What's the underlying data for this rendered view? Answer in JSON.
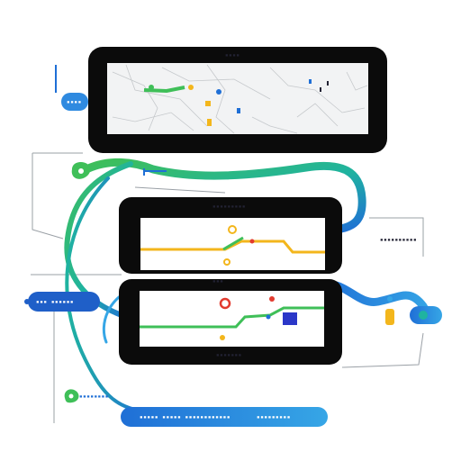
{
  "colors": {
    "frame": "#0b0b0b",
    "panel_bg": "#ffffff",
    "map_bg": "#f2f3f4",
    "blue": "#1f6fd6",
    "blue_light": "#36a6e6",
    "teal": "#1fb3a0",
    "green": "#3fbf58",
    "yellow": "#f3b61c",
    "red": "#e23b2f",
    "navy": "#2b37c8",
    "thin_line": "#9aa0a6"
  },
  "labels": {
    "map_title": "▪▪▪▪",
    "panel_a_title": "▪▪▪▪▪▪▪▪▪",
    "panel_b_title": "▪▪▪",
    "panel_b_footer": "▪▪▪▪▪▪▪",
    "right_caption": "▪▪▪▪▪▪▪▪▪▪",
    "left_pill": "▪▪▪ ▪▪▪▪▪▪",
    "top_left_pill": "▪▪▪▪",
    "bottom_bar_left": "▪▪▪▪▪ ▪▪▪▪▪ ▪▪▪▪▪▪▪▪▪▪▪▪",
    "bottom_bar_right": "▪▪▪▪▪▪▪▪▪",
    "bottom_left_caption": "▪▪▪▪▪▪▪▪"
  },
  "icons": {
    "map_pin": "map-pin-icon",
    "route_node": "route-node-icon",
    "stop_marker": "stop-marker-icon",
    "square_badge": "square-badge-icon"
  }
}
